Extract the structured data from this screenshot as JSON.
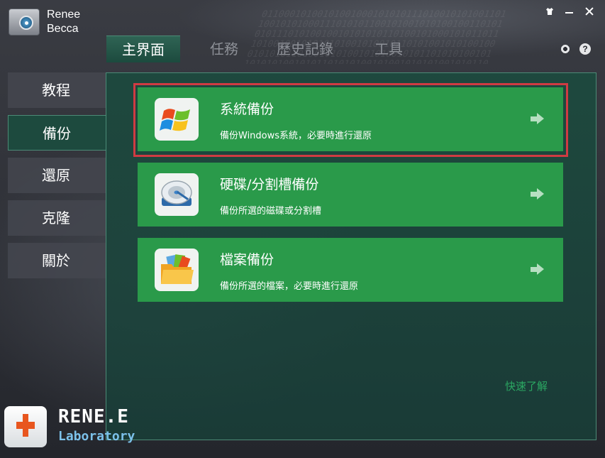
{
  "app": {
    "name_line1": "Renee",
    "name_line2": "Becca",
    "logo_icon": "safe-icon"
  },
  "window_controls": {
    "skin": "shirt-icon",
    "minimize": "minimize-icon",
    "close": "close-icon"
  },
  "tabs": [
    {
      "label": "主界面",
      "active": true
    },
    {
      "label": "任務",
      "active": false
    },
    {
      "label": "歷史記錄",
      "active": false
    },
    {
      "label": "工具",
      "active": false
    }
  ],
  "top_icons": {
    "settings": "gear-icon",
    "help": "?"
  },
  "sidebar": {
    "items": [
      {
        "label": "教程",
        "active": false
      },
      {
        "label": "備份",
        "active": true
      },
      {
        "label": "還原",
        "active": false
      },
      {
        "label": "克隆",
        "active": false
      },
      {
        "label": "關於",
        "active": false
      }
    ]
  },
  "cards": [
    {
      "title": "系統備份",
      "description": "備份Windows系統，必要時進行還原",
      "icon": "windows-logo-icon",
      "highlighted": true
    },
    {
      "title": "硬碟/分割槽備份",
      "description": "備份所選的磁碟或分割槽",
      "icon": "hard-disk-icon",
      "highlighted": false
    },
    {
      "title": "檔案備份",
      "description": "備份所選的檔案，必要時進行還原",
      "icon": "folder-icon",
      "highlighted": false
    }
  ],
  "quick_link": "快速了解",
  "footer": {
    "brand": "RENE.E",
    "sub": "Laboratory",
    "icon": "first-aid-kit-icon"
  },
  "colors": {
    "card_green": "#2a9a4a",
    "panel_teal": "#1c4a3e",
    "highlight_red": "#d03b42",
    "link_green": "#2ba863"
  }
}
